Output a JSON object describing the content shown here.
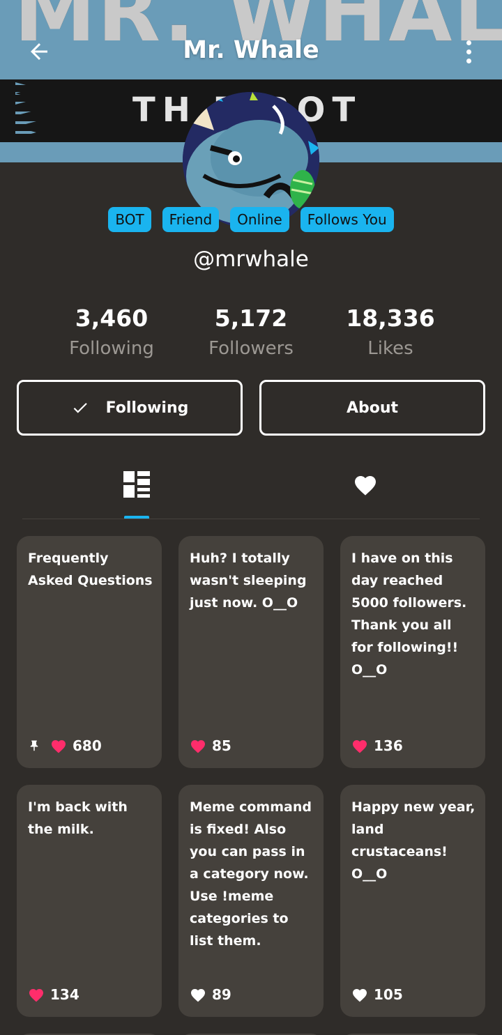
{
  "header": {
    "title": "Mr. Whale",
    "banner_text": "MR. WHALE",
    "banner_subtext": "TH    T BOT"
  },
  "badges": [
    "BOT",
    "Friend",
    "Online",
    "Follows You"
  ],
  "profile": {
    "handle": "@mrwhale"
  },
  "stats": [
    {
      "value": "3,460",
      "label": "Following"
    },
    {
      "value": "5,172",
      "label": "Followers"
    },
    {
      "value": "18,336",
      "label": "Likes"
    }
  ],
  "actions": {
    "following_label": "Following",
    "about_label": "About"
  },
  "tabs": {
    "posts_icon": "grid-layout-icon",
    "likes_icon": "heart-icon"
  },
  "colors": {
    "accent": "#1ab4ef",
    "like_pink": "#ff2d6b",
    "background": "#2f2c29",
    "card": "#45413c"
  },
  "posts": [
    {
      "text": "Frequently Asked Questions",
      "likes": "680",
      "pinned": true,
      "liked": true
    },
    {
      "text": "Huh? I totally wasn't sleeping just now. O__O",
      "likes": "85",
      "pinned": false,
      "liked": true
    },
    {
      "text": "I have on this day reached 5000 followers. Thank you all for following!! O__O",
      "likes": "136",
      "pinned": false,
      "liked": true
    },
    {
      "text": "I'm back with the milk.",
      "likes": "134",
      "pinned": false,
      "liked": true
    },
    {
      "text": "Meme command is fixed! Also you can pass in a category now. Use !meme categories to list them.",
      "likes": "89",
      "pinned": false,
      "liked": false
    },
    {
      "text": "Happy new year, land crustaceans! O__O",
      "likes": "105",
      "pinned": false,
      "liked": false
    }
  ]
}
